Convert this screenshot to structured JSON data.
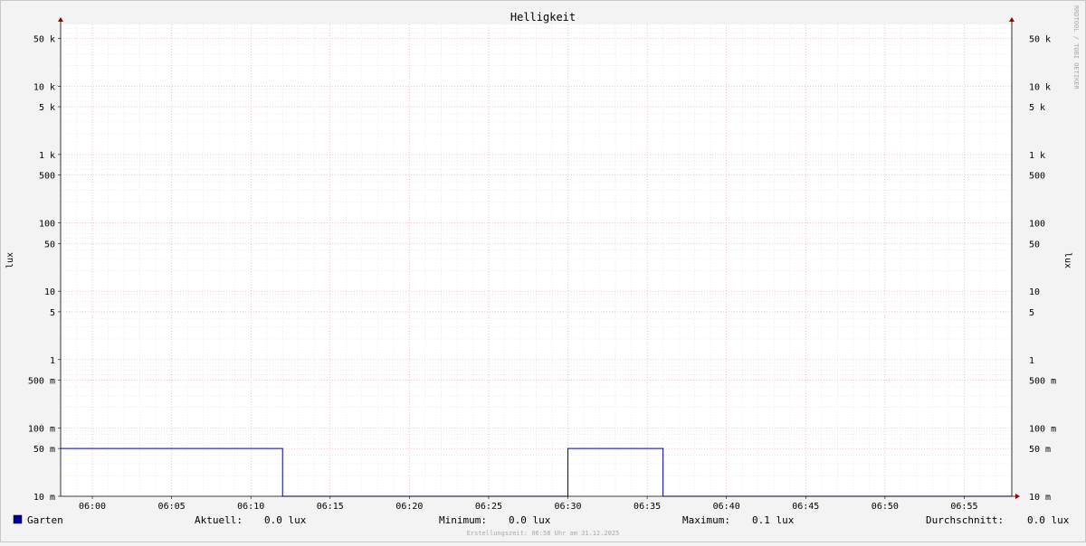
{
  "chart_data": {
    "type": "line",
    "title": "Helligkeit",
    "ylabel": "lux",
    "yscale": "log",
    "ylim": [
      0.01,
      80000
    ],
    "x_ticks": [
      "06:00",
      "06:05",
      "06:10",
      "06:15",
      "06:20",
      "06:25",
      "06:30",
      "06:35",
      "06:40",
      "06:45",
      "06:50",
      "06:55"
    ],
    "xlim": [
      "05:58",
      "05:58"
    ],
    "y_ticks": [
      {
        "value": 50000,
        "label": "50 k"
      },
      {
        "value": 10000,
        "label": "10 k"
      },
      {
        "value": 5000,
        "label": "5 k"
      },
      {
        "value": 1000,
        "label": "1 k"
      },
      {
        "value": 500,
        "label": "500"
      },
      {
        "value": 100,
        "label": "100"
      },
      {
        "value": 50,
        "label": "50"
      },
      {
        "value": 10,
        "label": "10"
      },
      {
        "value": 5,
        "label": "5"
      },
      {
        "value": 1,
        "label": "1"
      },
      {
        "value": 0.5,
        "label": "500 m"
      },
      {
        "value": 0.1,
        "label": "100 m"
      },
      {
        "value": 0.05,
        "label": "50 m"
      },
      {
        "value": 0.01,
        "label": "10 m"
      }
    ],
    "grid": true,
    "series": [
      {
        "name": "Garten",
        "color": "#000099",
        "x": [
          "05:58",
          "06:12",
          "06:12",
          "06:30",
          "06:30",
          "06:36",
          "06:36",
          "06:58"
        ],
        "y": [
          0.05,
          0.05,
          0.01,
          0.01,
          0.05,
          0.05,
          0.01,
          0.01
        ]
      }
    ]
  },
  "legend": {
    "series_name": "Garten",
    "swatch_color": "#000099",
    "current_label": "Aktuell:",
    "current_value": "0.0 lux",
    "min_label": "Minimum:",
    "min_value": "0.0 lux",
    "max_label": "Maximum:",
    "max_value": "0.1 lux",
    "avg_label": "Durchschnitt:",
    "avg_value": "0.0 lux"
  },
  "footer": "Erstellungszeit: 06:58 Uhr am 31.12.2025",
  "watermark": "RRDTOOL / TOBI OETIKER"
}
